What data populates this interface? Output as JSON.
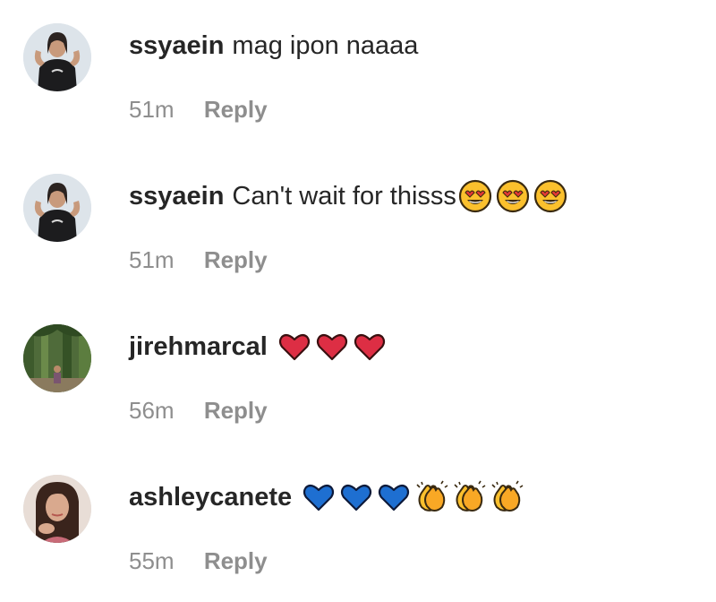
{
  "comments": [
    {
      "username": "ssyaein",
      "text": "mag ipon naaaa",
      "time": "51m",
      "reply_label": "Reply",
      "emojis": []
    },
    {
      "username": "ssyaein",
      "text": "Can't wait for thisss",
      "time": "51m",
      "reply_label": "Reply",
      "emojis": [
        "heart-eyes-emoji",
        "heart-eyes-emoji",
        "heart-eyes-emoji"
      ]
    },
    {
      "username": "jirehmarcal",
      "text": "",
      "time": "56m",
      "reply_label": "Reply",
      "emojis": [
        "red-heart-emoji",
        "red-heart-emoji",
        "red-heart-emoji"
      ]
    },
    {
      "username": "ashleycanete",
      "text": "",
      "time": "55m",
      "reply_label": "Reply",
      "emojis": [
        "blue-heart-emoji",
        "blue-heart-emoji",
        "blue-heart-emoji",
        "clapping-hands-emoji",
        "clapping-hands-emoji",
        "clapping-hands-emoji"
      ]
    }
  ],
  "colors": {
    "username": "#262626",
    "meta": "#8e8e8e",
    "red_heart": "#dd2e44",
    "blue_heart": "#1e6fd1",
    "emoji_yellow": "#fbc02d"
  }
}
